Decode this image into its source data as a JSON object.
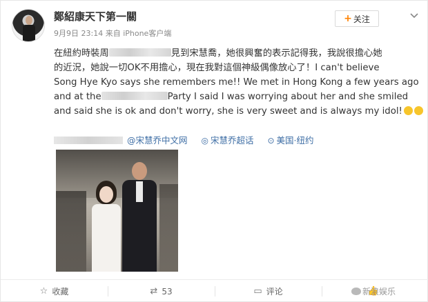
{
  "user": {
    "name": "鄭紹康天下第一關",
    "post_date": "9月9日 23:14",
    "source": "来自 iPhone客户端"
  },
  "header": {
    "follow_label": "关注",
    "follow_icon": "plus-icon",
    "menu_icon": "chevron-down-icon"
  },
  "post": {
    "lines": {
      "l1a": "在紐約時裝周",
      "l1b": "見到宋慧喬，她很興奮的表示記得我，我說很擔心她",
      "l2": "的近況，她說一切OK不用擔心，現在我對這個神級偶像放心了！I can't believe",
      "l3": "Song Hye Kyo says she remembers me!! We met in Hong Kong a few years ago",
      "l4a": "and at the",
      "l4b": "Party I said I was worrying about her and she smiled",
      "l5": "and said she is ok and don't worry, she is very sweet and is always my idol!"
    }
  },
  "tags": {
    "mention": "@宋慧乔中文网",
    "supertopic": "宋慧乔超话",
    "location": "美国·纽约",
    "supertopic_icon": "supertopic-icon",
    "location_icon": "location-pin-icon"
  },
  "actions": {
    "favorite": "收藏",
    "repost": "53",
    "comment": "评论",
    "like": ""
  },
  "watermark": {
    "text": "新浪娱乐"
  },
  "colors": {
    "link": "#3e6ea5",
    "accent": "#ff8200",
    "text": "#333333",
    "muted": "#888888"
  }
}
